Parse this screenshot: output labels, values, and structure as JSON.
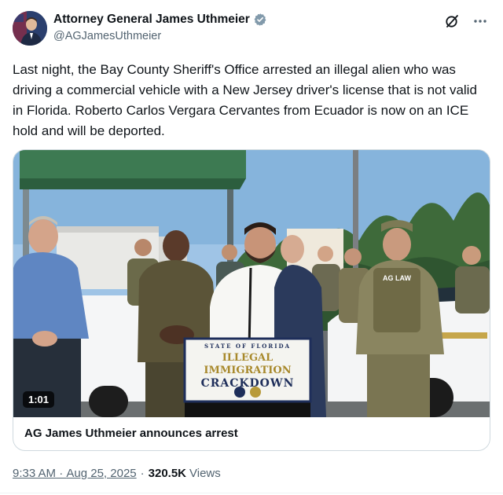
{
  "author": {
    "display_name": "Attorney General James Uthmeier",
    "handle": "@AGJamesUthmeier",
    "verified_badge_color": "#829aab"
  },
  "tweet": {
    "text": "Last night, the Bay County Sheriff's Office arrested an illegal alien who was driving a commercial vehicle with a New Jersey driver's license that is not valid in Florida. Roberto Carlos Vergara Cervantes from Ecuador is now on an ICE hold and will be deported."
  },
  "media": {
    "duration": "1:01",
    "title": "AG James Uthmeier announces arrest",
    "podium_sign": {
      "line1": "STATE OF FLORIDA",
      "line2": "ILLEGAL IMMIGRATION",
      "line3": "CRACKDOWN"
    },
    "vest_text": "AG LAW"
  },
  "meta": {
    "time": "9:33 AM",
    "date": "Aug 25, 2025",
    "views_count": "320.5K",
    "views_label": "Views"
  },
  "icons": {
    "grok": "grok-slash-icon",
    "more": "more-dots-icon",
    "verified": "verified-badge-icon"
  }
}
